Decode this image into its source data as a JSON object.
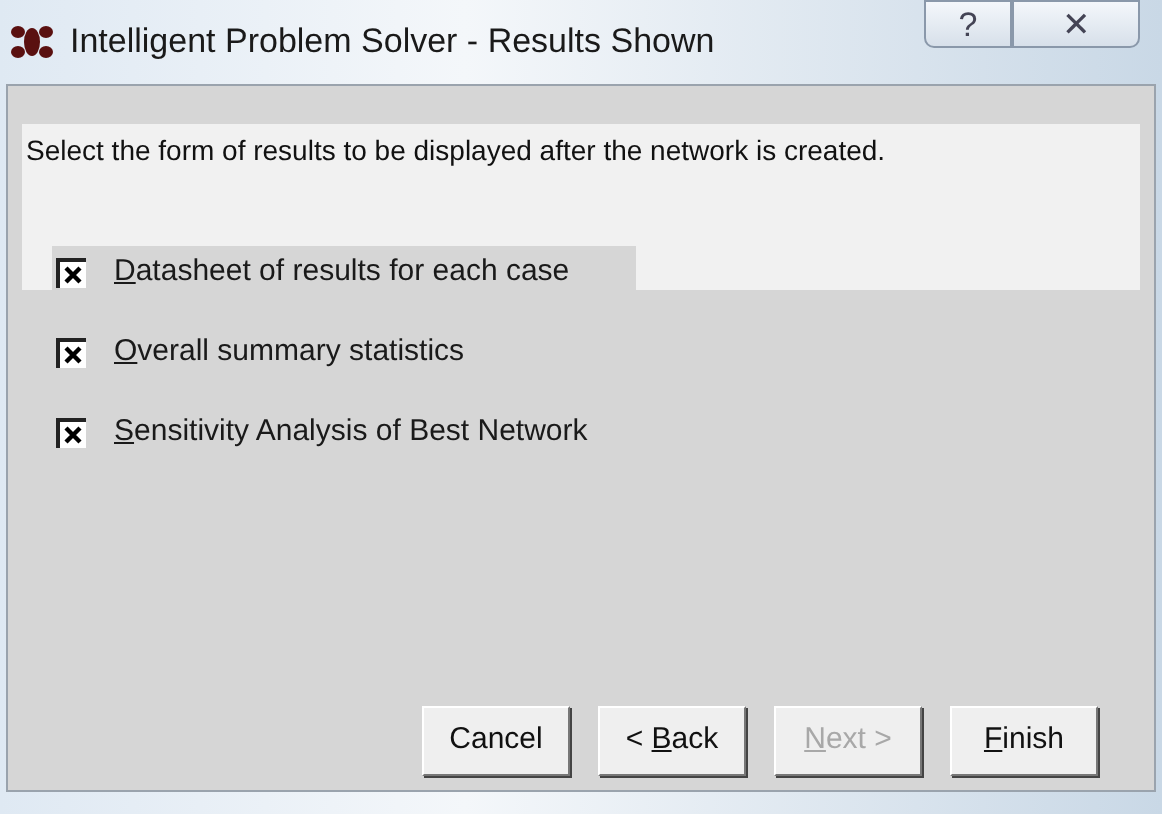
{
  "window": {
    "title": "Intelligent Problem Solver - Results Shown",
    "title_buttons": [
      {
        "kind": "help",
        "label": "?"
      },
      {
        "kind": "close",
        "label": "✕"
      }
    ]
  },
  "instruction": "Select the form of results to be displayed after the network is created.",
  "options": [
    {
      "label": {
        "key": "D",
        "after": "atasheet of results for each case"
      },
      "checked": true,
      "focused": true
    },
    {
      "label": {
        "key": "O",
        "after": "verall summary statistics"
      },
      "checked": true,
      "focused": false
    },
    {
      "label": {
        "key": "S",
        "after": "ensitivity Analysis of Best Network"
      },
      "checked": true,
      "focused": false
    }
  ],
  "buttons": [
    {
      "label": {
        "before": "Cancel"
      },
      "disabled": false
    },
    {
      "label": {
        "before": "< ",
        "key": "B",
        "after": "ack"
      },
      "disabled": false
    },
    {
      "label": {
        "key": "N",
        "after": "ext >"
      },
      "disabled": true
    },
    {
      "label": {
        "key": "F",
        "after": "inish"
      },
      "disabled": false
    }
  ]
}
